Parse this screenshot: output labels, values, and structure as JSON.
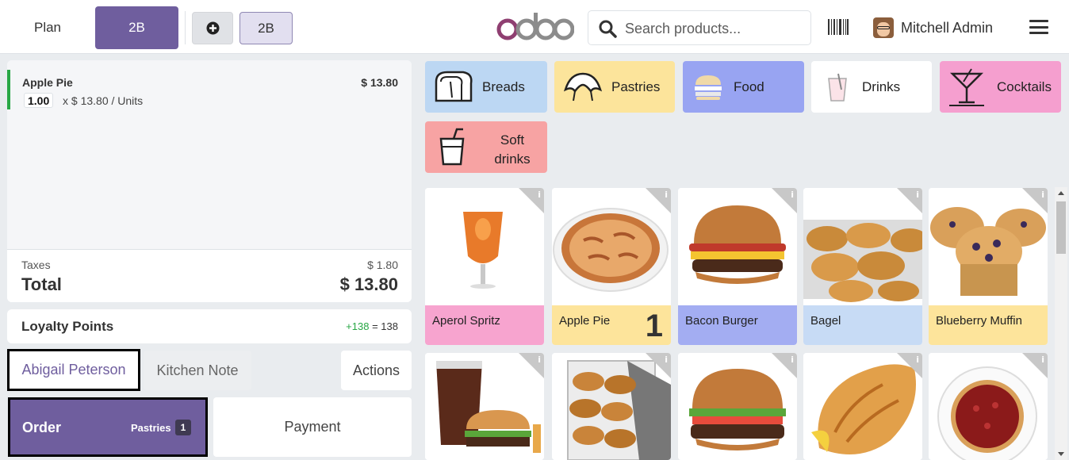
{
  "topbar": {
    "plan_label": "Plan",
    "table_label": "2B",
    "add_order_icon": "plus-circle-icon",
    "order_tab_label": "2B",
    "logo_text": "odoo",
    "search_placeholder": "Search products...",
    "user_name": "Mitchell Admin"
  },
  "order": {
    "line": {
      "name": "Apple Pie",
      "price": "$ 13.80",
      "qty": "1.00",
      "unit": "x $ 13.80 / Units"
    },
    "taxes_label": "Taxes",
    "taxes_value": "$ 1.80",
    "total_label": "Total",
    "total_value": "$ 13.80"
  },
  "loyalty": {
    "label": "Loyalty Points",
    "gain": "+138",
    "eq": " = ",
    "total": "138"
  },
  "controls": {
    "customer": "Abigail Peterson",
    "kitchen_note": "Kitchen Note",
    "actions": "Actions",
    "order_label": "Order",
    "order_category": "Pastries",
    "order_count": "1",
    "payment_label": "Payment"
  },
  "categories": [
    {
      "name": "Breads",
      "color": "#bcd7f3",
      "icon": "bread-icon"
    },
    {
      "name": "Pastries",
      "color": "#fce49b",
      "icon": "croissant-icon"
    },
    {
      "name": "Food",
      "color": "#98a4f2",
      "icon": "burger-icon"
    },
    {
      "name": "Drinks",
      "color": "#ffffff",
      "icon": "drink-glass-icon"
    },
    {
      "name": "Cocktails",
      "color": "#f59fcf",
      "icon": "cocktail-icon"
    },
    {
      "name": "Soft drinks",
      "color": "#f7a3a3",
      "icon": "soft-drink-icon"
    }
  ],
  "products": [
    {
      "name": "Aperol Spritz",
      "color": "#f7a4cf",
      "qty": ""
    },
    {
      "name": "Apple Pie",
      "color": "#fde49b",
      "qty": "1"
    },
    {
      "name": "Bacon Burger",
      "color": "#a3adf2",
      "qty": ""
    },
    {
      "name": "Bagel",
      "color": "#c7dbf5",
      "qty": ""
    },
    {
      "name": "Blueberry Muffin",
      "color": "#fde49b",
      "qty": ""
    }
  ]
}
